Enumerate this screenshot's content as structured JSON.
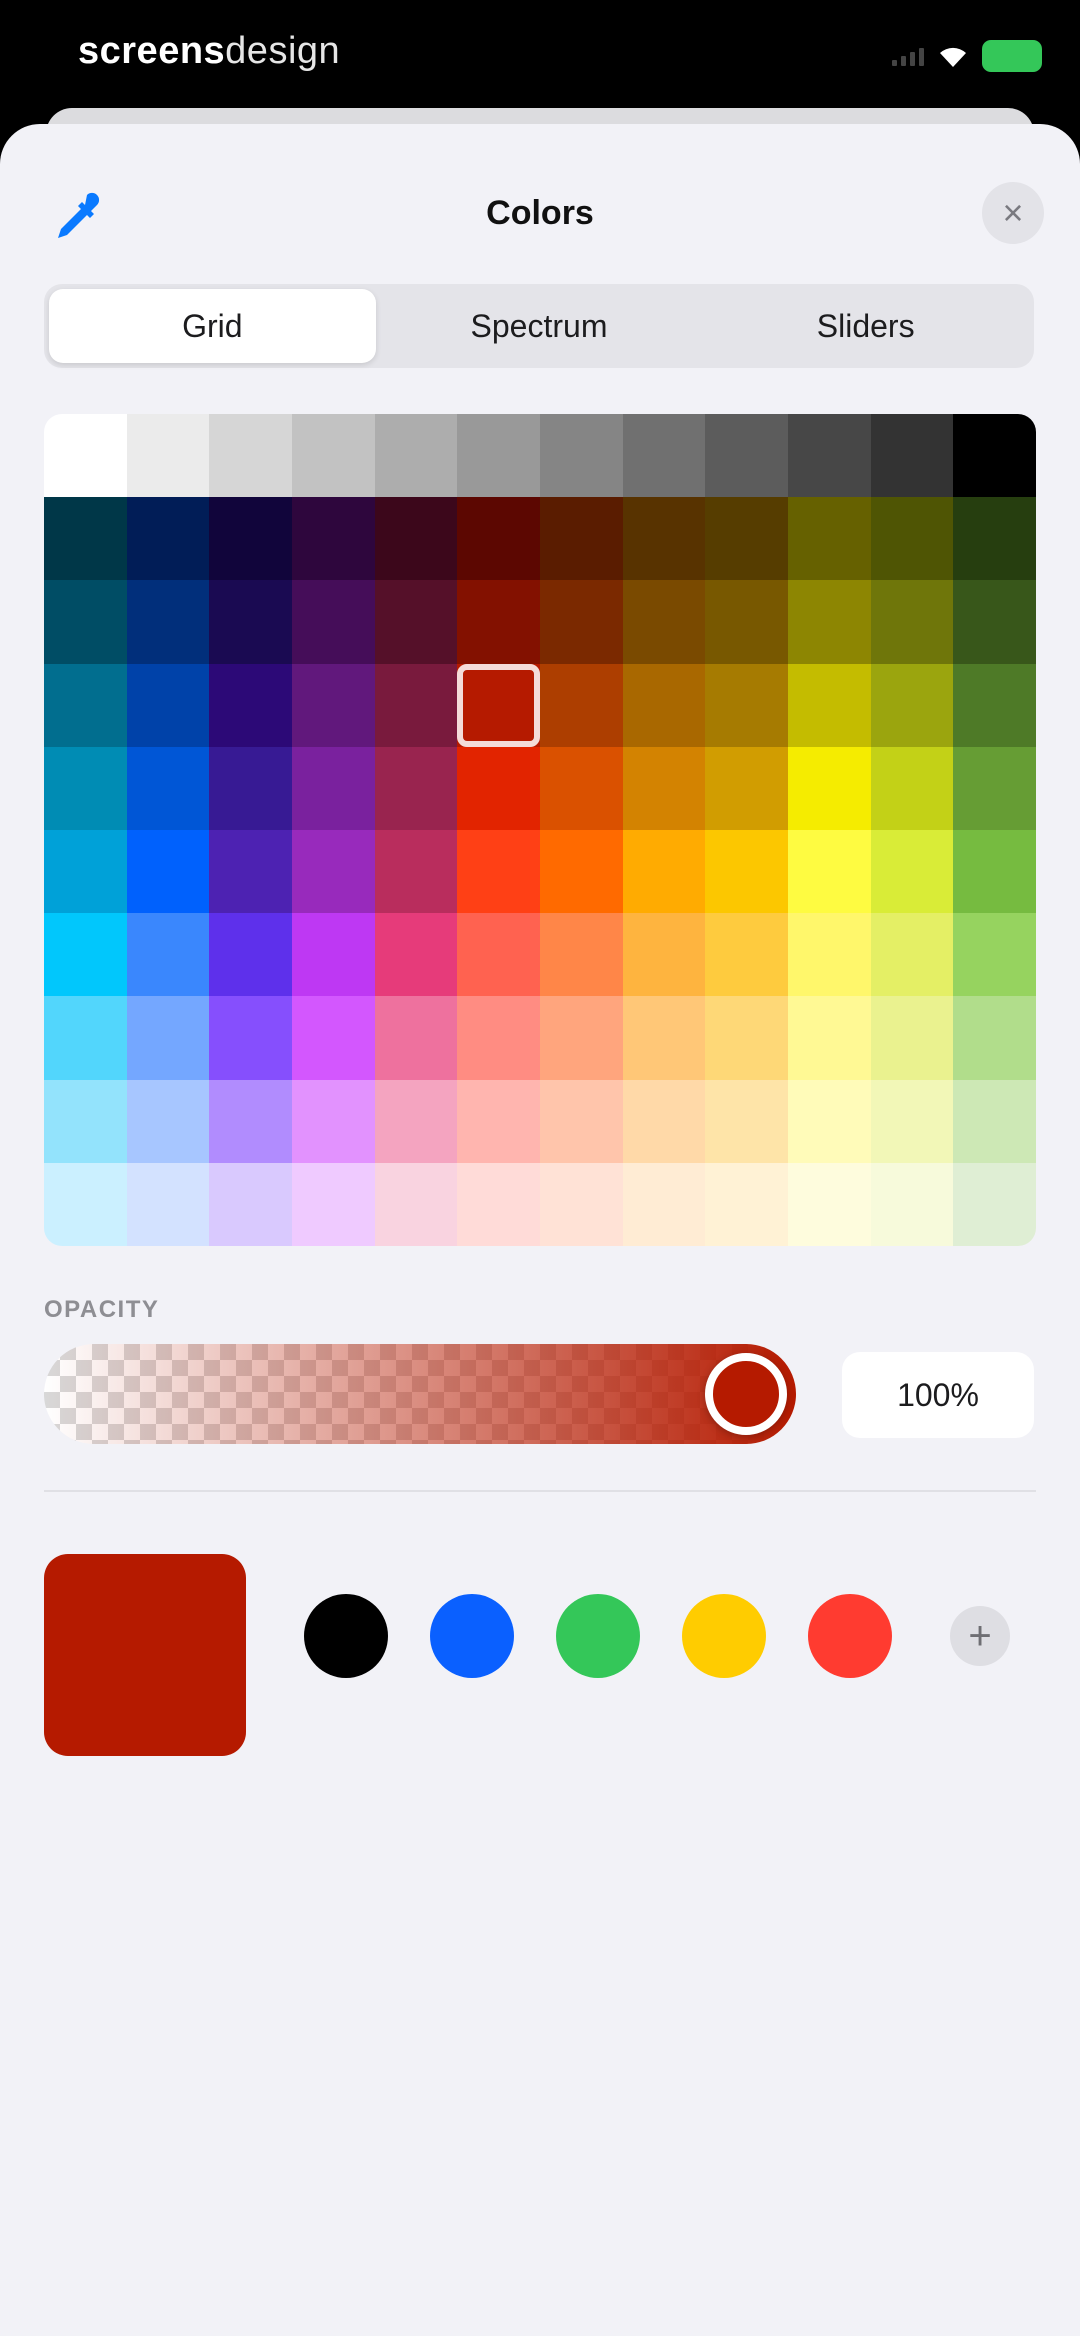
{
  "status_bar": {
    "brand_bold": "screens",
    "brand_light": "design",
    "signal_icon": "cellular-signal-icon",
    "wifi_icon": "wifi-icon",
    "battery_icon": "battery-icon",
    "battery_color": "#34c759"
  },
  "header": {
    "title": "Colors",
    "eyedropper_icon": "eyedropper-icon",
    "close_icon": "close-icon",
    "close_glyph": "×"
  },
  "tabs": [
    {
      "label": "Grid",
      "active": true
    },
    {
      "label": "Spectrum",
      "active": false
    },
    {
      "label": "Sliders",
      "active": false
    }
  ],
  "grid": {
    "columns": 12,
    "rows": 10,
    "selected": {
      "row": 3,
      "col": 5
    },
    "colors": [
      [
        "#ffffff",
        "#ebebeb",
        "#d6d6d6",
        "#c2c2c2",
        "#adadad",
        "#999999",
        "#858585",
        "#707070",
        "#5c5c5c",
        "#474747",
        "#333333",
        "#000000"
      ],
      [
        "#003748",
        "#011d57",
        "#11053b",
        "#2e063d",
        "#3c071b",
        "#5c0701",
        "#5a1c00",
        "#583300",
        "#563d00",
        "#666100",
        "#4f5504",
        "#263e0f"
      ],
      [
        "#004d65",
        "#012f7b",
        "#1a0a52",
        "#450d59",
        "#551029",
        "#831100",
        "#7b2900",
        "#7a4a00",
        "#785800",
        "#8d8602",
        "#6f760a",
        "#38571a"
      ],
      [
        "#016e8f",
        "#0042a9",
        "#2c0977",
        "#61187c",
        "#791a3d",
        "#b51a00",
        "#ad3e00",
        "#a96800",
        "#a67b01",
        "#c4bc00",
        "#9ba50e",
        "#4e7a27"
      ],
      [
        "#008cb4",
        "#0056d6",
        "#371a94",
        "#7a219e",
        "#99244f",
        "#e22400",
        "#da5100",
        "#d38301",
        "#d19d01",
        "#f5ec00",
        "#c3d117",
        "#669d34"
      ],
      [
        "#00a1d8",
        "#0061fd",
        "#4d22b2",
        "#982abc",
        "#b92d5d",
        "#ff4015",
        "#ff6a00",
        "#ffab01",
        "#fcc700",
        "#fefb41",
        "#d9ec37",
        "#76bb40"
      ],
      [
        "#01c7fc",
        "#3a87fd",
        "#5e30eb",
        "#be38f3",
        "#e63b7a",
        "#ff6250",
        "#ff8648",
        "#feb43f",
        "#fecb3e",
        "#fff76b",
        "#e4ef65",
        "#96d35f"
      ],
      [
        "#52d6fc",
        "#74a7ff",
        "#864ffd",
        "#d357fe",
        "#ee719e",
        "#ff8c82",
        "#ff a57d",
        "#ffc777",
        "#fed877",
        "#fff994",
        "#eaf28f",
        "#b1dd8b"
      ],
      [
        "#93e3fc",
        "#a7c6ff",
        "#b18cfe",
        "#e292fe",
        "#f4a4c0",
        "#ffb5af",
        "#ffc5ab",
        "#ffd9a8",
        "#fee4a8",
        "#fffbb9",
        "#f2f7b7",
        "#cde8b5"
      ],
      [
        "#cbf0ff",
        "#d3e2ff",
        "#d9c9fe",
        "#efcaff",
        "#f9d3e0",
        "#ffdbd8",
        "#ffe2d6",
        "#ffecd4",
        "#fff2d5",
        "#fefcdd",
        "#f7fadb",
        "#dfeed4"
      ]
    ]
  },
  "opacity": {
    "label": "OPACITY",
    "value_text": "100%",
    "value": 1.0,
    "color": "#b51a00"
  },
  "current_color": "#b51a00",
  "saved_swatches": [
    {
      "name": "swatch-black",
      "color": "#000000"
    },
    {
      "name": "swatch-blue",
      "color": "#0a60ff"
    },
    {
      "name": "swatch-green",
      "color": "#34c759"
    },
    {
      "name": "swatch-yellow",
      "color": "#ffcc00"
    },
    {
      "name": "swatch-red",
      "color": "#ff3b30"
    }
  ],
  "add_swatch": {
    "icon": "plus-icon",
    "glyph": "+"
  }
}
